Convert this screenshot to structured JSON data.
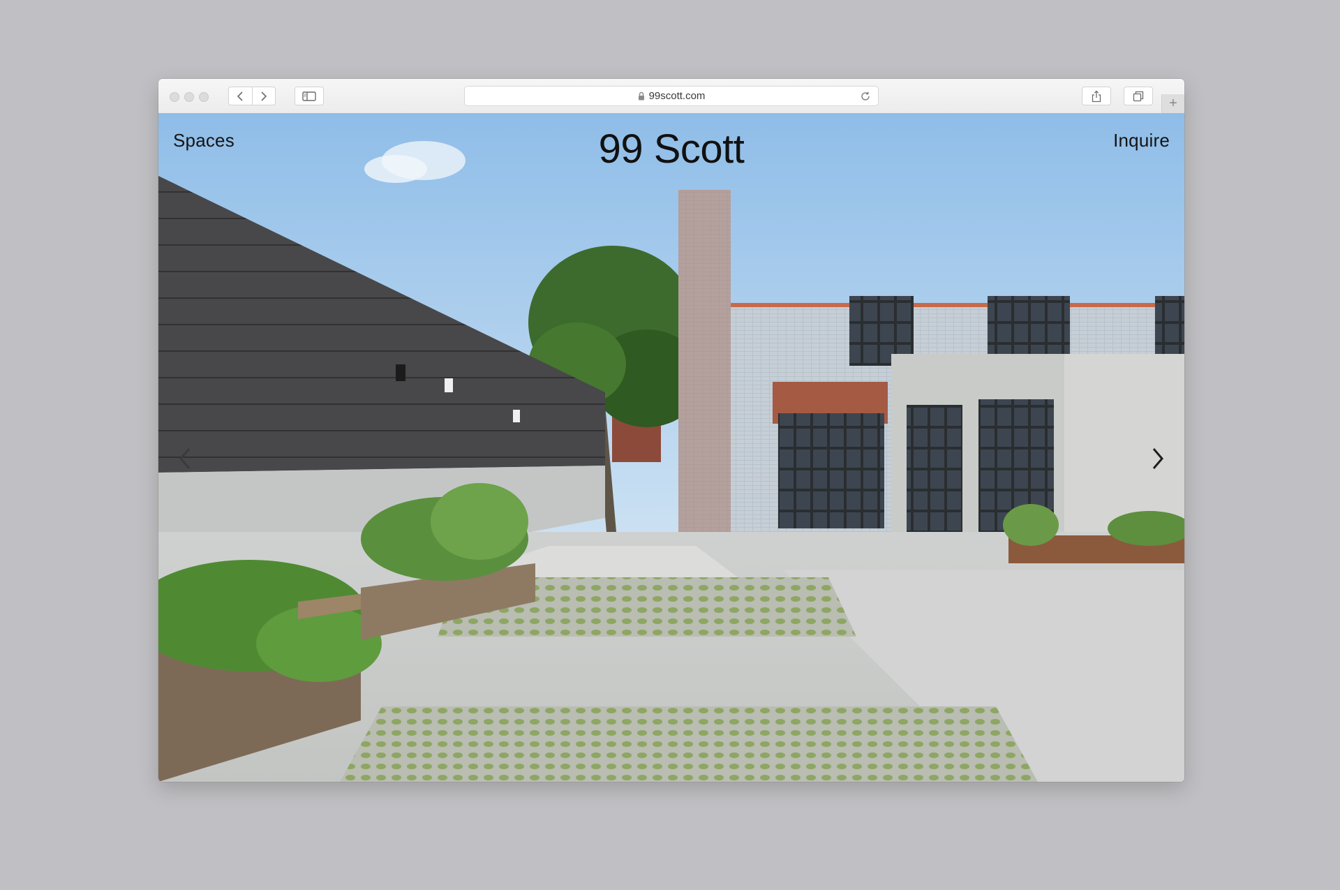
{
  "browser": {
    "url": "99scott.com",
    "new_tab_label": "+"
  },
  "site": {
    "title": "99 Scott",
    "nav_left": "Spaces",
    "nav_right": "Inquire"
  },
  "icons": {
    "prev": "chevron-left-icon",
    "next": "chevron-right-icon",
    "lock": "lock-icon",
    "reload": "reload-icon",
    "share": "share-icon",
    "tabs": "tabs-overview-icon",
    "sidebar": "sidebar-icon"
  },
  "colors": {
    "sky": "#a9ccec",
    "nav_text": "#141414",
    "page_bg": "#c0c0c4"
  }
}
